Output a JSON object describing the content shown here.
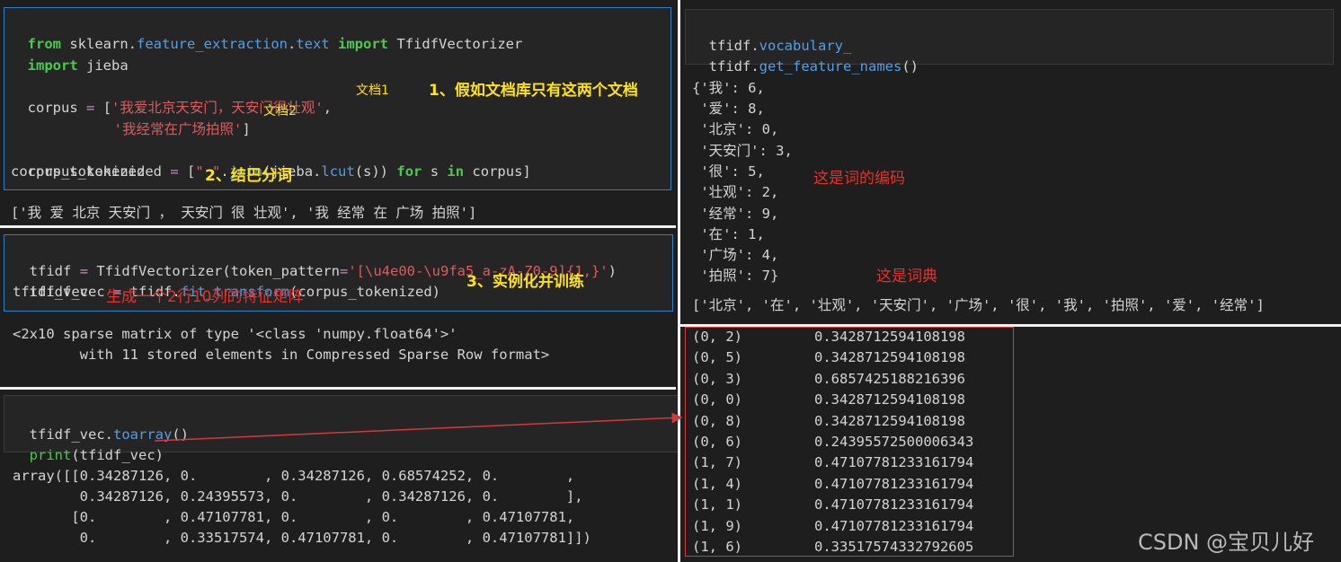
{
  "left": {
    "cell1": {
      "l1": {
        "kw_from": "from",
        "mod": "sklearn",
        "dot1": ".",
        "feat": "feature_extraction",
        "dot2": ".",
        "text": "text",
        "kw_import": "import",
        "cls": "TfidfVectorizer"
      },
      "l2": {
        "kw_import": "import",
        "mod": "jieba"
      },
      "l3": {
        "var": "corpus",
        "eq": "=",
        "pre": "[",
        "s1": "'我爱北京天安门，天安门很壮观'",
        "comma": ","
      },
      "l4": {
        "s2": "'我经常在广场拍照'",
        "close": "]"
      },
      "l5": {
        "var": "corpus_tokenized",
        "eq": "=",
        "pre": "[",
        "s3": "\" \"",
        "dot": ".",
        "join": "join",
        "arg": "(jieba.",
        "lcut": "lcut",
        "rest": "(s))",
        "kw_for": "for",
        "s": "s",
        "kw_in": "in",
        "tail": "corpus]"
      },
      "l6": "corpus_tokenized",
      "ann_doc1": "文档1",
      "ann_doc2": "文档2",
      "note1": "1、假如文档库只有这两个文档",
      "note2": "2、结巴分词"
    },
    "out1": "['我 爱 北京 天安门 ， 天安门 很 壮观', '我 经常 在 广场 拍照']",
    "cell2": {
      "l1": {
        "var": "tfidf",
        "eq": "=",
        "cls": "TfidfVectorizer(token_pattern",
        "eq2": "=",
        "str": "'[\\u4e00-\\u9fa5_a-zA-Z0-9]{1,}'",
        "close": ")"
      },
      "l2": {
        "var": "tfidf_vec",
        "eq": "=",
        "obj": "tfidf.",
        "fn": "fit_transform",
        "args": "(corpus_tokenized)"
      },
      "l3": "tfidf_vec",
      "note3": "3、实例化并训练",
      "note_red": "生成一个2行10列的特征矩阵"
    },
    "out2": {
      "l1": "<2x10 sparse matrix of type '<class 'numpy.float64'>'",
      "l2": "        with 11 stored elements in Compressed Sparse Row format>"
    },
    "cell3": {
      "l1": {
        "obj": "tfidf_vec.",
        "fn": "toarray",
        "args": "()"
      },
      "l2": {
        "fn": "print",
        "args": "(tfidf_vec)"
      }
    },
    "out3": [
      "array([[0.34287126, 0.        , 0.34287126, 0.68574252, 0.        ,",
      "        0.34287126, 0.24395573, 0.        , 0.34287126, 0.        ],",
      "       [0.        , 0.47107781, 0.        , 0.        , 0.47107781,",
      "        0.        , 0.33517574, 0.47107781, 0.        , 0.47107781]])"
    ]
  },
  "right": {
    "cell": {
      "l1": {
        "obj": "tfidf.",
        "attr": "vocabulary_"
      },
      "l2": {
        "obj": "tfidf.",
        "fn": "get_feature_names",
        "args": "()"
      }
    },
    "vocab": [
      "{'我': 6,",
      " '爱': 8,",
      " '北京': 0,",
      " '天安门': 3,",
      " '很': 5,",
      " '壮观': 2,",
      " '经常': 9,",
      " '在': 1,",
      " '广场': 4,",
      " '拍照': 7}"
    ],
    "note_code": "这是词的编码",
    "note_dict": "这是词典",
    "features": "['北京', '在', '壮观', '天安门', '广场', '很', '我', '拍照', '爱', '经常']",
    "sparse": [
      {
        "idx": "(0, 2)",
        "val": "0.3428712594108198"
      },
      {
        "idx": "(0, 5)",
        "val": "0.3428712594108198"
      },
      {
        "idx": "(0, 3)",
        "val": "0.6857425188216396"
      },
      {
        "idx": "(0, 0)",
        "val": "0.3428712594108198"
      },
      {
        "idx": "(0, 8)",
        "val": "0.3428712594108198"
      },
      {
        "idx": "(0, 6)",
        "val": "0.24395572500006343"
      },
      {
        "idx": "(1, 7)",
        "val": "0.47107781233161794"
      },
      {
        "idx": "(1, 4)",
        "val": "0.47107781233161794"
      },
      {
        "idx": "(1, 1)",
        "val": "0.47107781233161794"
      },
      {
        "idx": "(1, 9)",
        "val": "0.47107781233161794"
      },
      {
        "idx": "(1, 6)",
        "val": "0.33517574332792605"
      }
    ]
  },
  "watermark": "CSDN @宝贝儿好",
  "colors": {
    "keyword": "#4ec94e",
    "function": "#4fa0e8",
    "string": "#d95d5d",
    "operator": "#c586c0",
    "note_yellow": "#ffe11a",
    "note_red": "#e2342d",
    "cell_border": "#2f7fc6"
  }
}
